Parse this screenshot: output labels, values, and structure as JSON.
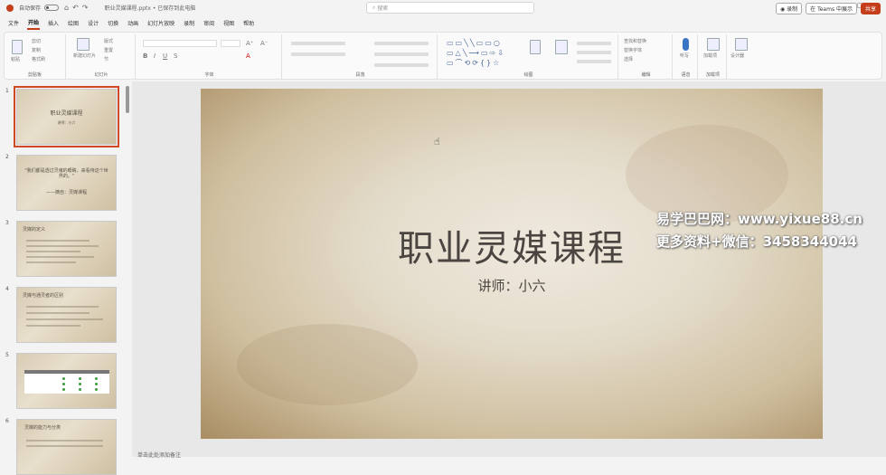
{
  "titlebar": {
    "autosave": "自动保存",
    "doc_title": "职业灵媒课程.pptx • 已保存到此电脑",
    "search_placeholder": "搜索",
    "min": "—",
    "max": "▢",
    "close": "✕"
  },
  "tabs": [
    "文件",
    "开始",
    "插入",
    "绘图",
    "设计",
    "切换",
    "动画",
    "幻灯片放映",
    "录制",
    "审阅",
    "视图",
    "帮助"
  ],
  "active_tab": "开始",
  "tab_right": {
    "record": "◉ 录制",
    "teams": "在 Teams 中展示",
    "share": "共享"
  },
  "ribbon": {
    "groups": [
      "剪贴板",
      "幻灯片",
      "字体",
      "段落",
      "绘图",
      "编辑",
      "语音",
      "加载项"
    ],
    "clipboard": {
      "paste": "粘贴",
      "cut": "剪切",
      "copy": "复制",
      "format": "格式刷"
    },
    "slides": {
      "new": "新建幻灯片",
      "layout": "版式",
      "reset": "重置",
      "section": "节"
    },
    "editing": {
      "find": "查找和替换",
      "replace": "替换字体",
      "select": "选择"
    },
    "voice": "听写",
    "addins": "加载项",
    "designer": "设计器"
  },
  "slides": [
    {
      "num": "1",
      "title": "职业灵媒课程",
      "sub": "讲师：小六"
    },
    {
      "num": "2",
      "quote": "\"我们都是透过灵魂的眼睛，来看待这个世界的。\"",
      "author": "——摘自：灵媒课程"
    },
    {
      "num": "3",
      "title": "灵媒的定义"
    },
    {
      "num": "4",
      "title": "灵媒与通灵者的区别"
    },
    {
      "num": "5",
      "title": ""
    },
    {
      "num": "6",
      "title": "灵媒的能力与分类"
    }
  ],
  "current_slide": {
    "title": "职业灵媒课程",
    "subtitle": "讲师：小六"
  },
  "watermark": {
    "line1": "易学巴巴网：www.yixue88.cn",
    "line2": "更多资料+微信：3458344044"
  },
  "notes": "单击此处添加备注"
}
